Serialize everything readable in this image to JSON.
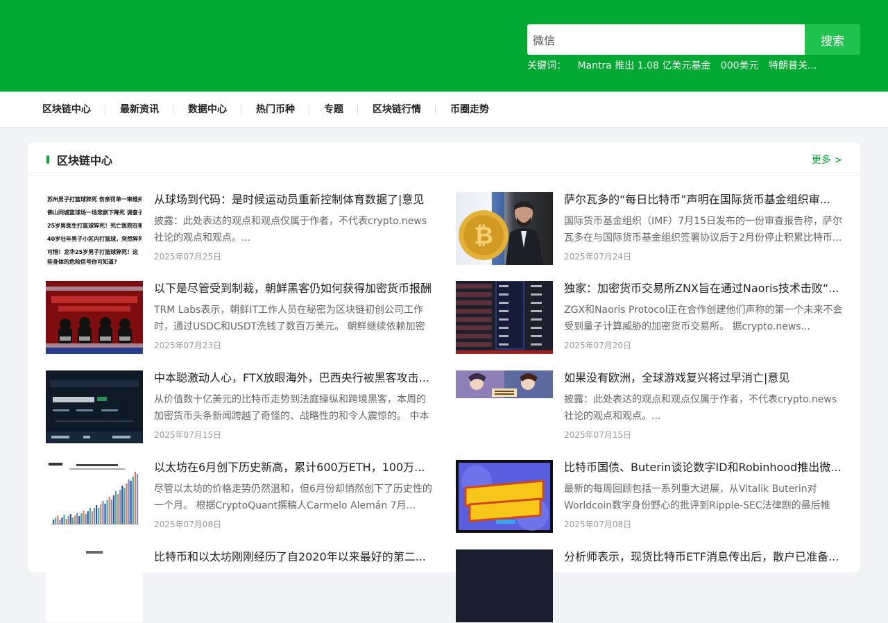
{
  "header": {
    "search_value": "微信",
    "search_button": "搜索",
    "keywords_label": "关键词：",
    "keywords": [
      "Mantra 推出 1.08 亿美元基金",
      "000美元",
      "特朗普关..."
    ]
  },
  "nav": [
    "区块链中心",
    "最新资讯",
    "数据中心",
    "热门币种",
    "专题",
    "区块链行情",
    "币圈走势"
  ],
  "section": {
    "title": "区块链中心",
    "more": "更多 >"
  },
  "articles": [
    {
      "title": "从球场到代码：是时候运动员重新控制体育数据了|意见",
      "summary": "披露：此处表达的观点和观点仅属于作者，不代表crypto.news社论的观点和观点。...",
      "date": "2025年07月25日",
      "thumb_text": [
        "苏州男子打篮球猝死 伤亲罚单一审维持原判",
        "佛山同城篮球场一场悲剧下降死 调查子已停学",
        "25岁男医生打篮球猝死！死亡医院在哪?",
        "40岁壮年男子小区内打篮球，突然猝死",
        "可惜！龙华25岁男子打篮球猝死！这些身体的危险信号你可知道?"
      ]
    },
    {
      "title": "萨尔瓦多的“每日比特币”声明在国际货币基金组织审...",
      "summary": "国际货币基金组织（IMF）7月15日发布的一份审查报告称，萨尔瓦多在与国际货币基金组织签署协议后于2月份停止积累比特币...",
      "date": "2025年07月24日"
    },
    {
      "title": "以下是尽管受到制裁，朝鲜黑客仍如何获得加密货币报酬",
      "summary": "TRM Labs表示，朝鲜IT工作人员在秘密为区块链初创公司工作时，通过USDC和USDT洗钱了数百万美元。 朝鲜继续依赖加密货币...",
      "date": "2025年07月23日"
    },
    {
      "title": "独家：加密货币交易所ZNX旨在通过Naoris技术击败“...",
      "summary": "ZGX和Naoris Protocol正在合作创建他们声称的第一个未来不会受到量子计算威胁的加密货币交易所。 据crypto.news...",
      "date": "2025年07月20日"
    },
    {
      "title": "中本聪激动人心，FTX放眼海外，巴西央行被黑客攻击...",
      "summary": "从价值数十亿美元的比特币走势到法庭操纵和跨境黑客，本周的加密货币头条新闻跨越了奇怪的、战略性的和令人震惊的。 中本聪...",
      "date": "2025年07月15日"
    },
    {
      "title": "如果没有欧洲，全球游戏复兴将过早消亡|意见",
      "summary": "披露：此处表达的观点和观点仅属于作者，不代表crypto.news社论的观点和观点。...",
      "date": "2025年07月15日"
    },
    {
      "title": "以太坊在6月创下历史新高，累计600万ETH，100万...",
      "summary": "尽管以太坊的价格走势仍然温和，但6月份却悄然创下了历史性的一个月。 根据CryptoQuant撰稿人Carmelo Alemán 7月...",
      "date": "2025年07月08日"
    },
    {
      "title": "比特币国债、Buterin谈论数字ID和Robinhood推出微...",
      "summary": "最新的每周回顾包括一系列重大进展，从Vitalik Buterin对Worldcoin数字身份野心的批评到Ripple-SEC法律剧的最后帷幕...",
      "date": "2025年07月08日"
    },
    {
      "title": "比特币和以太坊刚刚经历了自2020年以来最好的第二...",
      "summary": "",
      "date": ""
    },
    {
      "title": "分析师表示，现货比特币ETF消息传出后，散户已准备...",
      "summary": "",
      "date": ""
    }
  ]
}
